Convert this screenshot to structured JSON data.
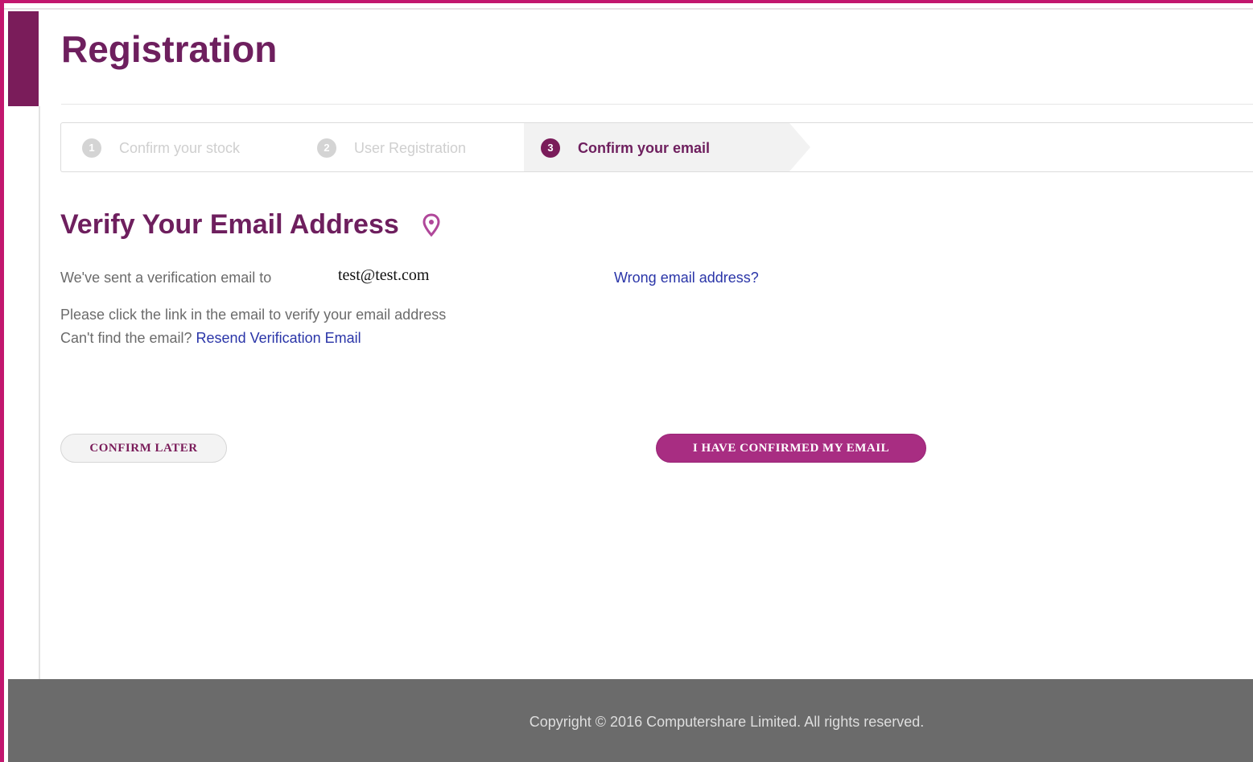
{
  "page": {
    "title": "Registration",
    "accent_color": "#c2166e",
    "brand_color": "#6e1f5e"
  },
  "stepper": {
    "steps": [
      {
        "number": "1",
        "label": "Confirm your stock",
        "state": "inactive"
      },
      {
        "number": "2",
        "label": "User Registration",
        "state": "inactive"
      },
      {
        "number": "3",
        "label": "Confirm your email",
        "state": "active"
      }
    ]
  },
  "verify": {
    "heading": "Verify Your Email Address",
    "heading_icon": "map-pin-icon",
    "sent_text": "We've sent a verification email to",
    "email": "test@test.com",
    "wrong_email_link": "Wrong email address?",
    "instruction": "Please click the link in the email to verify your email address",
    "cant_find_text": "Can't find the email?",
    "resend_link": "Resend Verification Email"
  },
  "actions": {
    "confirm_later": "CONFIRM LATER",
    "confirmed": "I HAVE CONFIRMED MY EMAIL"
  },
  "footer": {
    "copyright": "Copyright © 2016 Computershare Limited. All rights reserved."
  }
}
